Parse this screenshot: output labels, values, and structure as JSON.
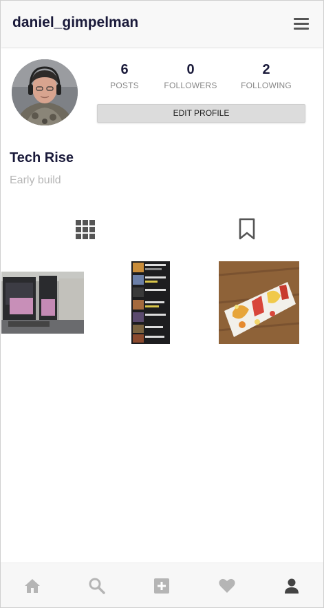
{
  "header": {
    "username": "daniel_gimpelman",
    "menu_icon": "hamburger-menu-icon"
  },
  "profile": {
    "stats": [
      {
        "count": "6",
        "label": "POSTS"
      },
      {
        "count": "0",
        "label": "FOLLOWERS"
      },
      {
        "count": "2",
        "label": "FOLLOWING"
      }
    ],
    "edit_button": "EDIT PROFILE",
    "display_name": "Tech Rise",
    "bio": "Early build"
  },
  "tabs": {
    "grid_icon": "grid-icon",
    "saved_icon": "bookmark-icon"
  },
  "posts": [
    "post-monitors",
    "post-app-list",
    "post-fruit-letters"
  ],
  "bottom_nav": [
    "home-icon",
    "search-icon",
    "add-post-icon",
    "heart-icon",
    "profile-icon"
  ],
  "colors": {
    "text_primary": "#1a1a3a",
    "muted": "#888888",
    "icon": "#555555",
    "nav_inactive": "#b5b5b5"
  }
}
